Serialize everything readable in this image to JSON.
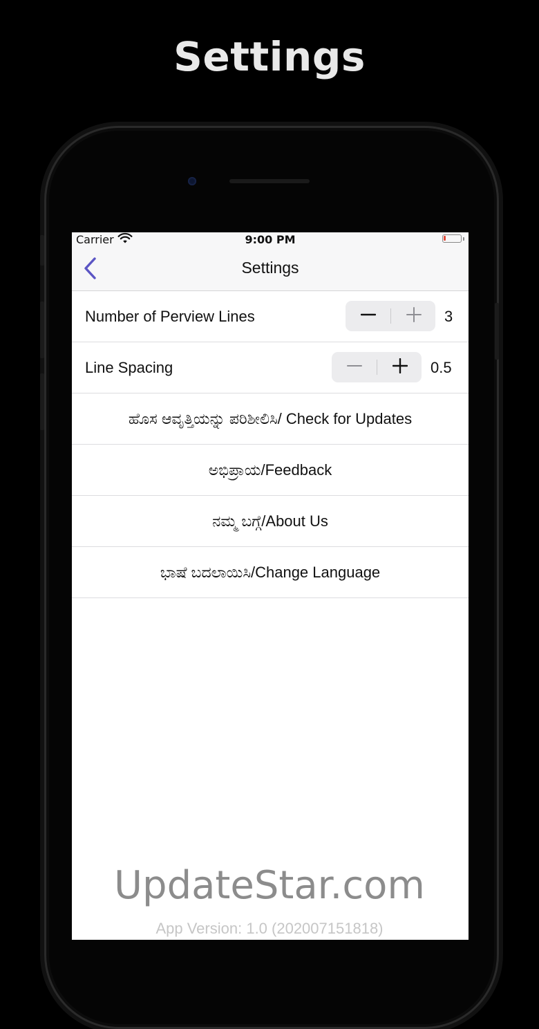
{
  "promo": {
    "title": "Settings"
  },
  "status_bar": {
    "carrier": "Carrier",
    "time": "9:00 PM",
    "battery_level": 0.1
  },
  "nav": {
    "title": "Settings",
    "back_icon": "chevron-left-icon",
    "accent": "#5b55c4"
  },
  "rows": {
    "preview_lines": {
      "label": "Number of Perview Lines",
      "value": "3"
    },
    "line_spacing": {
      "label": "Line Spacing",
      "value": "0.5"
    },
    "check_updates": {
      "label": "ಹೊಸ ಆವೃತ್ತಿಯನ್ನು ಪರಿಶೀಲಿಸಿ/ Check for Updates"
    },
    "feedback": {
      "label": "ಅಭಿಪ್ರಾಯ/Feedback"
    },
    "about": {
      "label": "ನಮ್ಮ ಬಗ್ಗೆ/About Us"
    },
    "language": {
      "label": "ಭಾಷೆ ಬದಲಾಯಿಸಿ/Change Language"
    }
  },
  "footer": {
    "watermark": "UpdateStar.com",
    "version": "App Version: 1.0 (202007151818)"
  }
}
